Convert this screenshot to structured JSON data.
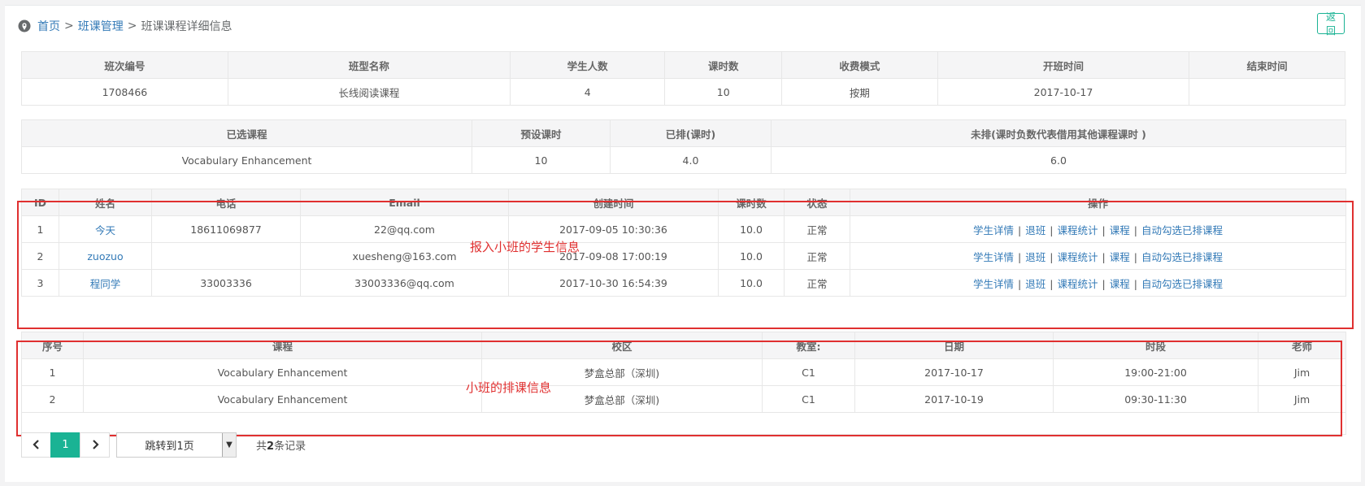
{
  "breadcrumb": {
    "home": "首页",
    "sep": ">",
    "section": "班课管理",
    "current": "班课课程详细信息"
  },
  "back_label": "返回",
  "class_info": {
    "headers": [
      "班次编号",
      "班型名称",
      "学生人数",
      "课时数",
      "收费模式",
      "开班时间",
      "结束时间"
    ],
    "row": [
      "1708466",
      "长线阅读课程",
      "4",
      "10",
      "按期",
      "2017-10-17",
      ""
    ]
  },
  "course_info": {
    "headers": [
      "已选课程",
      "预设课时",
      "已排(课时)",
      "未排(课时负数代表借用其他课程课时 )"
    ],
    "row": [
      "Vocabulary Enhancement",
      "10",
      "4.0",
      "6.0"
    ]
  },
  "students": {
    "headers": [
      "ID",
      "姓名",
      "电话",
      "Email",
      "创建时间",
      "课时数",
      "状态",
      "操作"
    ],
    "rows": [
      [
        "1",
        "今天",
        "18611069877",
        "22@qq.com",
        "2017-09-05 10:30:36",
        "10.0",
        "正常"
      ],
      [
        "2",
        "zuozuo",
        "",
        "xuesheng@163.com",
        "2017-09-08 17:00:19",
        "10.0",
        "正常"
      ],
      [
        "3",
        "程同学",
        "33003336",
        "33003336@qq.com",
        "2017-10-30 16:54:39",
        "10.0",
        "正常"
      ]
    ],
    "actions": [
      "学生详情",
      "退班",
      "课程统计",
      "课程",
      "自动勾选已排课程"
    ],
    "action_sep": "|"
  },
  "schedule": {
    "headers": [
      "序号",
      "课程",
      "校区",
      "教室:",
      "日期",
      "时段",
      "老师"
    ],
    "rows": [
      [
        "1",
        "Vocabulary Enhancement",
        "梦盒总部（深圳)",
        "C1",
        "2017-10-17",
        "19:00-21:00",
        "Jim"
      ],
      [
        "2",
        "Vocabulary Enhancement",
        "梦盒总部（深圳)",
        "C1",
        "2017-10-19",
        "09:30-11:30",
        "Jim"
      ]
    ]
  },
  "annotations": {
    "students_note": "报入小班的学生信息",
    "schedule_note": "小班的排课信息"
  },
  "pagination": {
    "current_page": "1",
    "jump_label": "跳转到1页",
    "total_prefix": "共",
    "total_count": "2",
    "total_suffix": "条记录"
  },
  "colors": {
    "link": "#337ab7",
    "accent": "#1ab394",
    "annotation": "#e03030"
  }
}
